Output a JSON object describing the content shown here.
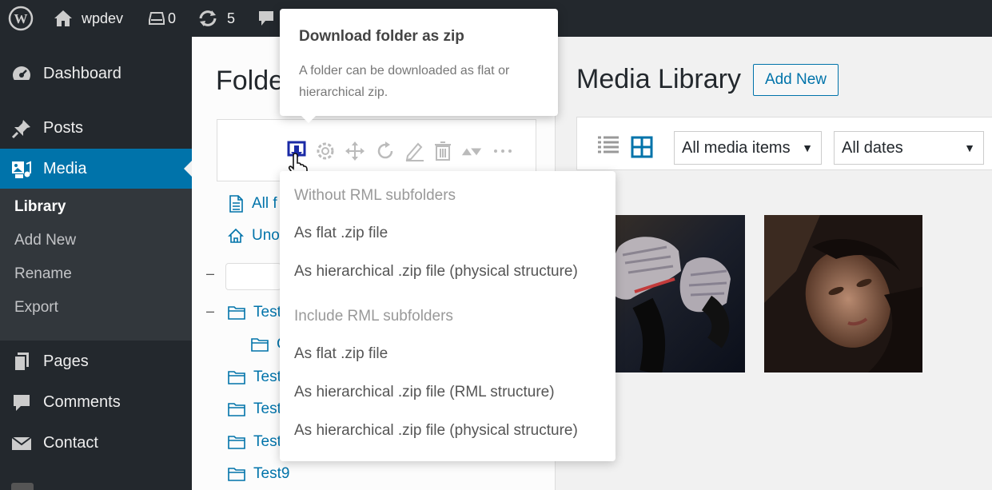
{
  "adminbar": {
    "site_name": "wpdev",
    "drafts_count": "0",
    "updates_count": "5"
  },
  "sidebar": {
    "items": [
      {
        "label": "Dashboard",
        "icon": "dashboard-icon"
      },
      {
        "label": "Posts",
        "icon": "pin-icon"
      },
      {
        "label": "Media",
        "icon": "media-icon"
      },
      {
        "label": "Pages",
        "icon": "pages-icon"
      },
      {
        "label": "Comments",
        "icon": "comment-icon"
      },
      {
        "label": "Contact",
        "icon": "mail-icon"
      }
    ],
    "submenu": [
      "Library",
      "Add New",
      "Rename",
      "Export"
    ]
  },
  "folders": {
    "title": "Folde",
    "tree": [
      {
        "label": "All f"
      },
      {
        "label": "Uno"
      },
      {
        "label": "Test"
      },
      {
        "label": "C"
      },
      {
        "label": "Test"
      },
      {
        "label": "Test"
      },
      {
        "label": "Test"
      },
      {
        "label": "Test9"
      }
    ]
  },
  "tooltip": {
    "title": "Download folder as zip",
    "body": "A folder can be downloaded as flat or hierarchical zip."
  },
  "download_menu": {
    "items": [
      {
        "label": "Without RML subfolders",
        "header": true
      },
      {
        "label": "As flat .zip file"
      },
      {
        "label": "As hierarchical .zip file (physical structure)"
      },
      {
        "label": "Include RML subfolders",
        "header": true
      },
      {
        "label": "As flat .zip file"
      },
      {
        "label": "As hierarchical .zip file (RML structure)"
      },
      {
        "label": "As hierarchical .zip file (physical structure)"
      }
    ]
  },
  "media_library": {
    "title": "Media Library",
    "add_new": "Add New",
    "filter_type": "All media items",
    "filter_date": "All dates"
  },
  "colors": {
    "admin_dark": "#23282d",
    "accent": "#0073aa",
    "submenu_bg": "#32373c"
  }
}
